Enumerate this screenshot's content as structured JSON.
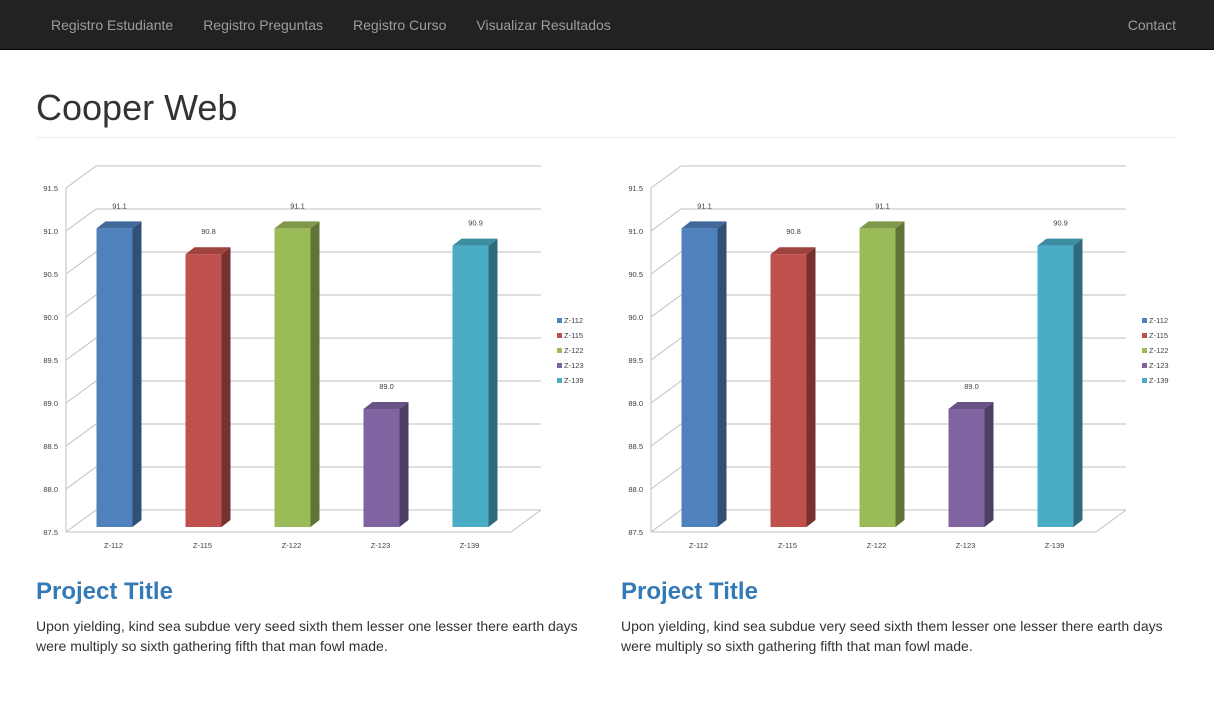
{
  "nav": {
    "items": [
      {
        "label": "Registro Estudiante"
      },
      {
        "label": "Registro Preguntas"
      },
      {
        "label": "Registro Curso"
      },
      {
        "label": "Visualizar Resultados"
      }
    ],
    "contact": "Contact"
  },
  "header": {
    "title": "Cooper Web"
  },
  "colors": {
    "navbar_bg": "#222222",
    "nav_text": "#9d9d9d",
    "link": "#337ab7"
  },
  "projects": [
    {
      "title": "Project Title",
      "description": "Upon yielding, kind sea subdue very seed sixth them lesser one lesser there earth days were multiply so sixth gathering fifth that man fowl made."
    },
    {
      "title": "Project Title",
      "description": "Upon yielding, kind sea subdue very seed sixth them lesser one lesser there earth days were multiply so sixth gathering fifth that man fowl made."
    }
  ],
  "chart_data": [
    {
      "type": "bar",
      "categories": [
        "Z-112",
        "Z-115",
        "Z-122",
        "Z-123",
        "Z-139"
      ],
      "values": [
        91.1,
        90.8,
        91.1,
        89.0,
        90.9
      ],
      "value_labels": [
        "91.1",
        "90.8",
        "91.1",
        "89.0",
        "90.9"
      ],
      "yticks": [
        "87.5",
        "88.0",
        "88.5",
        "89.0",
        "89.5",
        "90.0",
        "90.5",
        "91.0",
        "91.5"
      ],
      "ylim": [
        87.5,
        91.5
      ],
      "colors": [
        "#4f81bd",
        "#c0504d",
        "#9bbb59",
        "#8064a2",
        "#4bacc6"
      ],
      "legend": [
        "Z-112",
        "Z-115",
        "Z-122",
        "Z-123",
        "Z-139"
      ],
      "legend_position": "right",
      "grid": true,
      "style": "3d"
    },
    {
      "type": "bar",
      "categories": [
        "Z-112",
        "Z-115",
        "Z-122",
        "Z-123",
        "Z-139"
      ],
      "values": [
        91.1,
        90.8,
        91.1,
        89.0,
        90.9
      ],
      "value_labels": [
        "91.1",
        "90.8",
        "91.1",
        "89.0",
        "90.9"
      ],
      "yticks": [
        "87.5",
        "88.0",
        "88.5",
        "89.0",
        "89.5",
        "90.0",
        "90.5",
        "91.0",
        "91.5"
      ],
      "ylim": [
        87.5,
        91.5
      ],
      "colors": [
        "#4f81bd",
        "#c0504d",
        "#9bbb59",
        "#8064a2",
        "#4bacc6"
      ],
      "legend": [
        "Z-112",
        "Z-115",
        "Z-122",
        "Z-123",
        "Z-139"
      ],
      "legend_position": "right",
      "grid": true,
      "style": "3d"
    }
  ]
}
